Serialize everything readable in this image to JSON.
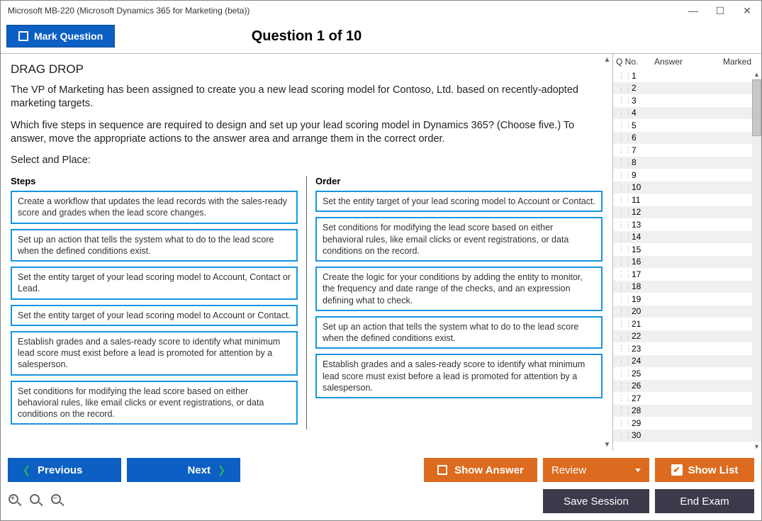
{
  "window": {
    "title": "Microsoft MB-220 (Microsoft Dynamics 365 for Marketing (beta))"
  },
  "header": {
    "mark_label": "Mark Question",
    "indicator": "Question 1 of 10"
  },
  "question": {
    "type_label": "DRAG DROP",
    "para1": "The VP of Marketing has been assigned to create you a new lead scoring model for Contoso, Ltd. based on recently-adopted marketing targets.",
    "para2": "Which five steps in sequence are required to design and set up your lead scoring model in Dynamics 365? (Choose five.) To answer, move the appropriate actions to the answer area and arrange them in the correct order.",
    "select_label": "Select and Place:",
    "steps_head": "Steps",
    "order_head": "Order",
    "steps": [
      "Create a workflow that updates the lead records with the sales-ready score and grades when the lead score changes.",
      "Set up an action that tells the system what to do to the lead score when the defined conditions exist.",
      "Set the entity target of your lead scoring model to Account, Contact or Lead.",
      "Set the entity target of your lead scoring model to Account or Contact.",
      "Establish grades and a sales-ready score to identify what minimum lead score must exist before a lead is promoted for attention by a salesperson.",
      "Set conditions for modifying the lead score based on either behavioral rules, like email clicks or event registrations, or data conditions on the record."
    ],
    "order": [
      "Set the entity target of your lead scoring model to Account or Contact.",
      "Set conditions for modifying the lead score based on either behavioral rules, like email clicks or event registrations, or data conditions on the record.",
      "Create the logic for your conditions by adding the entity to monitor, the frequency and date range of the checks, and an expression defining what to check.",
      "Set up an action that tells the system what to do to the lead score when the defined conditions exist.",
      "Establish grades and a sales-ready score to identify what minimum lead score must exist before a lead is promoted for attention by a salesperson."
    ]
  },
  "side": {
    "head_no": "Q No.",
    "head_answer": "Answer",
    "head_marked": "Marked",
    "rows": [
      1,
      2,
      3,
      4,
      5,
      6,
      7,
      8,
      9,
      10,
      11,
      12,
      13,
      14,
      15,
      16,
      17,
      18,
      19,
      20,
      21,
      22,
      23,
      24,
      25,
      26,
      27,
      28,
      29,
      30
    ]
  },
  "footer": {
    "previous": "Previous",
    "next": "Next",
    "show_answer": "Show Answer",
    "review": "Review",
    "show_list": "Show List",
    "save_session": "Save Session",
    "end_exam": "End Exam"
  }
}
